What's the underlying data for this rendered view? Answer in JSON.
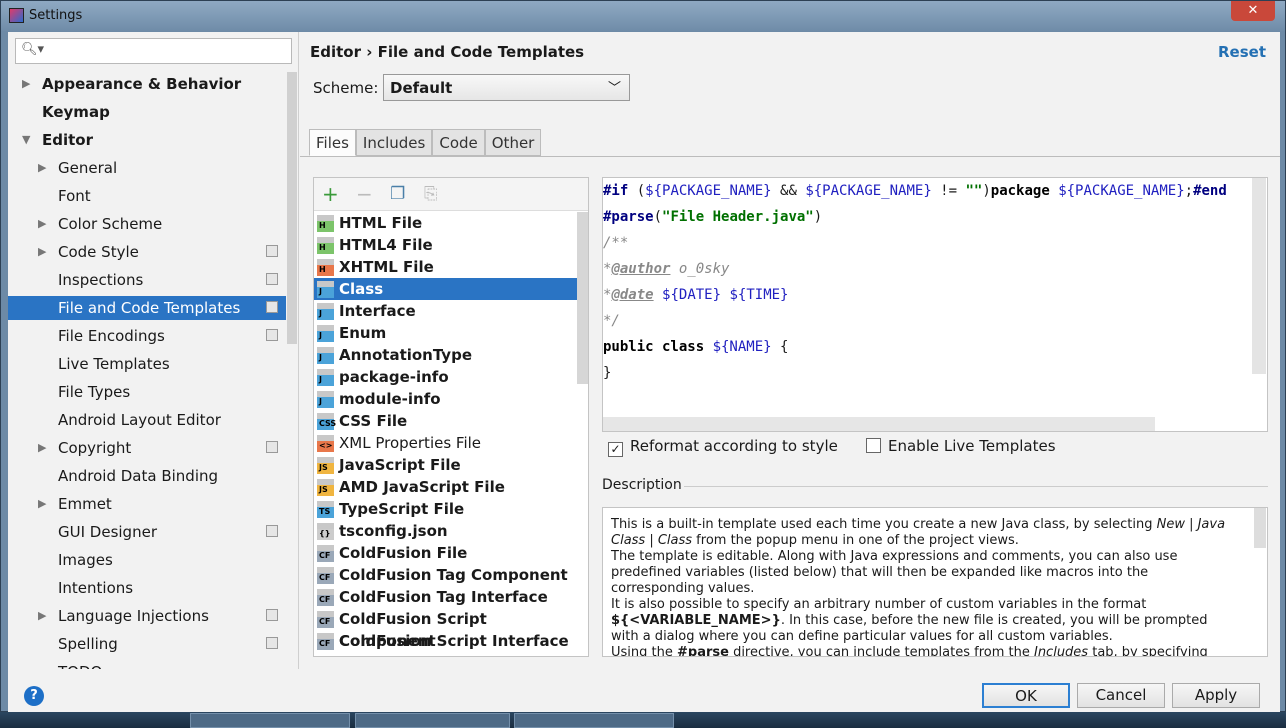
{
  "window": {
    "title": "Settings"
  },
  "search": {
    "placeholder": ""
  },
  "sidebar": {
    "items": [
      {
        "label": "Appearance & Behavior",
        "bold": true,
        "arrow": "right",
        "level": 0
      },
      {
        "label": "Keymap",
        "bold": true,
        "arrow": "",
        "level": 0
      },
      {
        "label": "Editor",
        "bold": true,
        "arrow": "down",
        "level": 0
      },
      {
        "label": "General",
        "arrow": "right",
        "level": 1
      },
      {
        "label": "Font",
        "arrow": "",
        "level": 1
      },
      {
        "label": "Color Scheme",
        "arrow": "right",
        "level": 1
      },
      {
        "label": "Code Style",
        "arrow": "right",
        "level": 1,
        "copy": true
      },
      {
        "label": "Inspections",
        "arrow": "",
        "level": 1,
        "copy": true
      },
      {
        "label": "File and Code Templates",
        "arrow": "",
        "level": 1,
        "copy": true,
        "selected": true
      },
      {
        "label": "File Encodings",
        "arrow": "",
        "level": 1,
        "copy": true
      },
      {
        "label": "Live Templates",
        "arrow": "",
        "level": 1
      },
      {
        "label": "File Types",
        "arrow": "",
        "level": 1
      },
      {
        "label": "Android Layout Editor",
        "arrow": "",
        "level": 1
      },
      {
        "label": "Copyright",
        "arrow": "right",
        "level": 1,
        "copy": true
      },
      {
        "label": "Android Data Binding",
        "arrow": "",
        "level": 1
      },
      {
        "label": "Emmet",
        "arrow": "right",
        "level": 1
      },
      {
        "label": "GUI Designer",
        "arrow": "",
        "level": 1,
        "copy": true
      },
      {
        "label": "Images",
        "arrow": "",
        "level": 1
      },
      {
        "label": "Intentions",
        "arrow": "",
        "level": 1
      },
      {
        "label": "Language Injections",
        "arrow": "right",
        "level": 1,
        "copy": true
      },
      {
        "label": "Spelling",
        "arrow": "",
        "level": 1,
        "copy": true
      },
      {
        "label": "TODO",
        "arrow": "",
        "level": 1
      }
    ]
  },
  "header": {
    "breadcrumb_parent": "Editor",
    "breadcrumb_sep": "›",
    "breadcrumb_current": "File and Code Templates",
    "reset": "Reset"
  },
  "scheme": {
    "label": "Scheme:",
    "value": "Default"
  },
  "tabs": [
    {
      "label": "Files",
      "active": true
    },
    {
      "label": "Includes"
    },
    {
      "label": "Code"
    },
    {
      "label": "Other"
    }
  ],
  "templates": [
    {
      "label": "HTML File",
      "badge": "H",
      "color": "#7cc46a",
      "bold": true
    },
    {
      "label": "HTML4 File",
      "badge": "H",
      "color": "#7cc46a",
      "bold": true
    },
    {
      "label": "XHTML File",
      "badge": "H",
      "color": "#e8774a",
      "bold": true
    },
    {
      "label": "Class",
      "badge": "J",
      "color": "#4ba3d9",
      "bold": true,
      "selected": true
    },
    {
      "label": "Interface",
      "badge": "J",
      "color": "#4ba3d9",
      "bold": true
    },
    {
      "label": "Enum",
      "badge": "J",
      "color": "#4ba3d9",
      "bold": true
    },
    {
      "label": "AnnotationType",
      "badge": "J",
      "color": "#4ba3d9",
      "bold": true
    },
    {
      "label": "package-info",
      "badge": "J",
      "color": "#4ba3d9",
      "bold": true
    },
    {
      "label": "module-info",
      "badge": "J",
      "color": "#4ba3d9",
      "bold": true
    },
    {
      "label": "CSS File",
      "badge": "CSS",
      "color": "#4ba3d9",
      "bold": true
    },
    {
      "label": "XML Properties File",
      "badge": "<>",
      "color": "#e8774a",
      "bold": false
    },
    {
      "label": "JavaScript File",
      "badge": "JS",
      "color": "#f0b540",
      "bold": true
    },
    {
      "label": "AMD JavaScript File",
      "badge": "JS",
      "color": "#f0b540",
      "bold": true
    },
    {
      "label": "TypeScript File",
      "badge": "TS",
      "color": "#4ba3d9",
      "bold": true
    },
    {
      "label": "tsconfig.json",
      "badge": "{}",
      "color": "#cccccc",
      "bold": true
    },
    {
      "label": "ColdFusion File",
      "badge": "CF",
      "color": "#9aa8b8",
      "bold": true
    },
    {
      "label": "ColdFusion Tag Component",
      "badge": "CF",
      "color": "#9aa8b8",
      "bold": true
    },
    {
      "label": "ColdFusion Tag Interface",
      "badge": "CF",
      "color": "#9aa8b8",
      "bold": true
    },
    {
      "label": "ColdFusion Script Component",
      "badge": "CF",
      "color": "#9aa8b8",
      "bold": true
    },
    {
      "label": "ColdFusion Script Interface",
      "badge": "CF",
      "color": "#9aa8b8",
      "bold": true
    }
  ],
  "code": {
    "lines": [
      [
        {
          "t": "#if",
          "c": "kw"
        },
        {
          "t": " (",
          "c": ""
        },
        {
          "t": "${PACKAGE_NAME}",
          "c": "var"
        },
        {
          "t": " && ",
          "c": ""
        },
        {
          "t": "${PACKAGE_NAME}",
          "c": "var"
        },
        {
          "t": " != ",
          "c": ""
        },
        {
          "t": "\"\"",
          "c": "str"
        },
        {
          "t": ")",
          "c": ""
        },
        {
          "t": "package ",
          "c": "pl"
        },
        {
          "t": "${PACKAGE_NAME}",
          "c": "var"
        },
        {
          "t": ";",
          "c": ""
        },
        {
          "t": "#end",
          "c": "kw"
        }
      ],
      [
        {
          "t": "#parse",
          "c": "kw"
        },
        {
          "t": "(",
          "c": ""
        },
        {
          "t": "\"File Header.java\"",
          "c": "str"
        },
        {
          "t": ")",
          "c": ""
        }
      ],
      [
        {
          "t": "/**",
          "c": "cm"
        }
      ],
      [
        {
          "t": "*",
          "c": "cm"
        },
        {
          "t": "@author",
          "c": "cm tag"
        },
        {
          "t": " o_0sky",
          "c": "cm"
        }
      ],
      [
        {
          "t": "*",
          "c": "cm"
        },
        {
          "t": "@date",
          "c": "cm tag"
        },
        {
          "t": " ",
          "c": ""
        },
        {
          "t": "${DATE}",
          "c": "var"
        },
        {
          "t": " ",
          "c": ""
        },
        {
          "t": "${TIME}",
          "c": "var"
        }
      ],
      [
        {
          "t": "*/",
          "c": "cm"
        }
      ],
      [
        {
          "t": "public class ",
          "c": "pl"
        },
        {
          "t": "${NAME}",
          "c": "var"
        },
        {
          "t": " {",
          "c": ""
        }
      ],
      [
        {
          "t": "}",
          "c": ""
        }
      ]
    ]
  },
  "options": {
    "reformat": {
      "label": "Reformat according to style",
      "checked": true
    },
    "live_templates": {
      "label": "Enable Live Templates",
      "checked": false
    }
  },
  "description": {
    "label": "Description",
    "p1a": "This is a built-in template used each time you create a new Java class, by selecting ",
    "p1i": "New | Java Class | Class",
    "p1b": " from the popup menu in one of the project views.",
    "p2": "The template is editable. Along with Java expressions and comments, you can also use predefined variables (listed below) that will then be expanded like macros into the corresponding values.",
    "p3a": "It is also possible to specify an arbitrary number of custom variables in the format ",
    "p3b": "${<VARIABLE_NAME>}",
    "p3c": ". In this case, before the new file is created, you will be prompted with a dialog where you can define particular values for all custom variables.",
    "p4a": "Using the ",
    "p4b": "#parse",
    "p4c": " directive, you can include templates from the ",
    "p4i": "Includes",
    "p4d": " tab, by specifying the full name of the desired template as a parameter in quotation marks. For example:"
  },
  "buttons": {
    "ok": "OK",
    "cancel": "Cancel",
    "apply": "Apply",
    "help": "?"
  }
}
